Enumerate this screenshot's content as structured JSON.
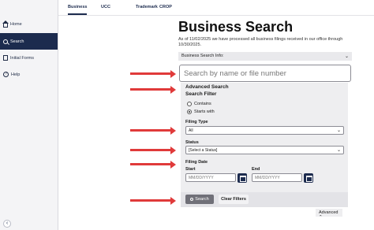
{
  "sidebar": {
    "items": [
      {
        "label": "Home",
        "icon": "home-icon"
      },
      {
        "label": "Search",
        "icon": "search-icon",
        "active": true
      },
      {
        "label": "Initial Forms",
        "icon": "forms-icon"
      },
      {
        "label": "Help",
        "icon": "help-icon"
      }
    ],
    "collapse_glyph": "‹"
  },
  "tabs": [
    "Business",
    "UCC",
    "Trademark",
    "CROP"
  ],
  "page": {
    "title": "Business Search",
    "notice": "As of 11/02/2025 we have processed all business filings received in our office through 10/30/2025.",
    "info_label": "Business Search Info:",
    "search_placeholder": "Search by name or file number"
  },
  "advanced": {
    "title": "Advanced Search",
    "filter_title": "Search Filter",
    "radio_contains": "Contains",
    "radio_starts": "Starts with",
    "filing_type_label": "Filing Type",
    "filing_type_value": "All",
    "status_label": "Status",
    "status_value": "[Select a Status]",
    "filing_date_label": "Filing Date",
    "start_label": "Start",
    "end_label": "End",
    "date_placeholder": "MM/DD/YYYY",
    "search_button": "Search",
    "clear_button": "Clear Filters",
    "toggle_label": "Advanced"
  },
  "colors": {
    "nav_active": "#1c2b4e",
    "arrow": "#e03a3a"
  }
}
